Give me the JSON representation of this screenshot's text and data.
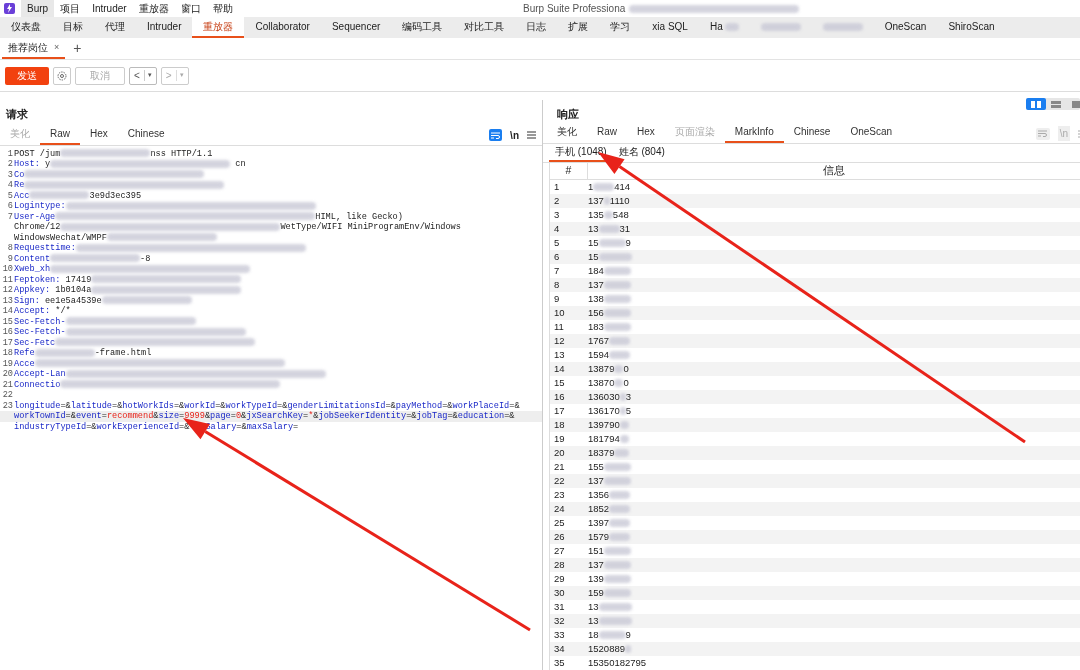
{
  "menu_bar": {
    "items": [
      {
        "label": "Burp",
        "selected": true
      },
      {
        "label": "项目",
        "selected": false
      },
      {
        "label": "Intruder",
        "selected": false
      },
      {
        "label": "重放器",
        "selected": false
      },
      {
        "label": "窗口",
        "selected": false
      },
      {
        "label": "帮助",
        "selected": false
      }
    ],
    "title": "Burp Suite Professiona"
  },
  "main_tabs": [
    {
      "label": "仪表盘",
      "selected": false
    },
    {
      "label": "目标",
      "selected": false
    },
    {
      "label": "代理",
      "selected": false
    },
    {
      "label": "Intruder",
      "selected": false
    },
    {
      "label": "重放器",
      "selected": true
    },
    {
      "label": "Collaborator",
      "selected": false
    },
    {
      "label": "Sequencer",
      "selected": false
    },
    {
      "label": "编码工具",
      "selected": false
    },
    {
      "label": "对比工具",
      "selected": false
    },
    {
      "label": "日志",
      "selected": false
    },
    {
      "label": "扩展",
      "selected": false
    },
    {
      "label": "学习",
      "selected": false
    },
    {
      "label": "xia SQL",
      "selected": false
    },
    {
      "label": "Ha",
      "selected": false,
      "redacted": true
    },
    {
      "selected": false,
      "redacted": true
    },
    {
      "selected": false,
      "redacted": true
    },
    {
      "label": "OneScan",
      "selected": false
    },
    {
      "label": "ShiroScan",
      "selected": false
    }
  ],
  "repeater_tabs": [
    {
      "label": "推荐岗位",
      "close": "×",
      "selected": true
    }
  ],
  "new_tab": "+",
  "toolbar": {
    "send": "发送",
    "cancel": "取消",
    "back": "<",
    "forward": ">",
    "dropdown": "▾"
  },
  "request": {
    "title": "请求",
    "tabs": [
      {
        "label": "美化",
        "selected": false,
        "disabled": true
      },
      {
        "label": "Raw",
        "selected": true,
        "disabled": false
      },
      {
        "label": "Hex",
        "selected": false,
        "disabled": false
      },
      {
        "label": "Chinese",
        "selected": false,
        "disabled": false
      }
    ],
    "newline_toggle": "\\n",
    "lines": [
      {
        "number": "1",
        "parts": [
          {
            "kind": "text",
            "text": "POST /jum"
          },
          {
            "kind": "redaction"
          },
          {
            "kind": "text",
            "text": "nss HTTP/1.1"
          }
        ]
      },
      {
        "number": "2",
        "parts": [
          {
            "kind": "name",
            "text": "Host:"
          },
          {
            "kind": "text",
            "text": " y"
          },
          {
            "kind": "redaction"
          },
          {
            "kind": "text",
            "text": " cn"
          }
        ]
      },
      {
        "number": "3",
        "parts": [
          {
            "kind": "name",
            "text": "Co"
          },
          {
            "kind": "redaction"
          }
        ]
      },
      {
        "number": "4",
        "parts": [
          {
            "kind": "name",
            "text": "Re"
          },
          {
            "kind": "redaction"
          }
        ]
      },
      {
        "number": "5",
        "parts": [
          {
            "kind": "name",
            "text": "Acc"
          },
          {
            "kind": "redaction"
          },
          {
            "kind": "text",
            "text": "3e9d3ec395"
          }
        ]
      },
      {
        "number": "6",
        "parts": [
          {
            "kind": "name",
            "text": "Logintype:"
          },
          {
            "kind": "redaction"
          }
        ]
      },
      {
        "number": "7",
        "parts": [
          {
            "kind": "name",
            "text": "User-Age"
          },
          {
            "kind": "redaction"
          },
          {
            "kind": "text",
            "text": "HIML, like Gecko)"
          }
        ]
      },
      {
        "parts": [
          {
            "kind": "text",
            "text": "Chrome/12"
          },
          {
            "kind": "redaction"
          },
          {
            "kind": "text",
            "text": "WetType/WIFI MiniProgramEnv/Windows"
          }
        ]
      },
      {
        "parts": [
          {
            "kind": "text",
            "text": "WindowsWechat/WMPF"
          },
          {
            "kind": "redaction"
          }
        ]
      },
      {
        "number": "8",
        "parts": [
          {
            "kind": "name",
            "text": "Requesttime:"
          },
          {
            "kind": "redaction"
          }
        ]
      },
      {
        "number": "9",
        "parts": [
          {
            "kind": "name",
            "text": "Content"
          },
          {
            "kind": "redaction"
          },
          {
            "kind": "text",
            "text": "-8"
          }
        ]
      },
      {
        "number": "10",
        "parts": [
          {
            "kind": "name",
            "text": "Xweb_xh"
          },
          {
            "kind": "redaction"
          }
        ]
      },
      {
        "number": "11",
        "parts": [
          {
            "kind": "name",
            "text": "Feptoken:"
          },
          {
            "kind": "text",
            "text": " 17419"
          },
          {
            "kind": "redaction"
          }
        ]
      },
      {
        "number": "12",
        "parts": [
          {
            "kind": "name",
            "text": "Appkey:"
          },
          {
            "kind": "text",
            "text": " 1b0104a"
          },
          {
            "kind": "redaction"
          }
        ]
      },
      {
        "number": "13",
        "parts": [
          {
            "kind": "name",
            "text": "Sign:"
          },
          {
            "kind": "text",
            "text": " ee1e5a4539e"
          },
          {
            "kind": "redaction"
          }
        ]
      },
      {
        "number": "14",
        "parts": [
          {
            "kind": "name",
            "text": "Accept:"
          },
          {
            "kind": "text",
            "text": " */*"
          }
        ]
      },
      {
        "number": "15",
        "parts": [
          {
            "kind": "name",
            "text": "Sec-Fetch-"
          },
          {
            "kind": "redaction"
          }
        ]
      },
      {
        "number": "16",
        "parts": [
          {
            "kind": "name",
            "text": "Sec-Fetch-"
          },
          {
            "kind": "redaction"
          }
        ]
      },
      {
        "number": "17",
        "parts": [
          {
            "kind": "name",
            "text": "Sec-Fetc"
          },
          {
            "kind": "redaction"
          }
        ]
      },
      {
        "number": "18",
        "parts": [
          {
            "kind": "name",
            "text": "Refe"
          },
          {
            "kind": "redaction"
          },
          {
            "kind": "text",
            "text": "-frame.html"
          }
        ]
      },
      {
        "number": "19",
        "parts": [
          {
            "kind": "name",
            "text": "Acce"
          },
          {
            "kind": "redaction"
          }
        ]
      },
      {
        "number": "20",
        "parts": [
          {
            "kind": "name",
            "text": "Accept-Lan"
          },
          {
            "kind": "redaction"
          }
        ]
      },
      {
        "number": "21",
        "parts": [
          {
            "kind": "name",
            "text": "Connectio"
          },
          {
            "kind": "redaction"
          }
        ]
      },
      {
        "number": "22"
      },
      {
        "number": "23",
        "parts": [
          {
            "kind": "name",
            "text": "longitude"
          },
          {
            "kind": "text",
            "text": "=&"
          },
          {
            "kind": "name",
            "text": "latitude"
          },
          {
            "kind": "text",
            "text": "=&"
          },
          {
            "kind": "name",
            "text": "hotWorkIds"
          },
          {
            "kind": "text",
            "text": "=&"
          },
          {
            "kind": "name",
            "text": "workId"
          },
          {
            "kind": "text",
            "text": "=&"
          },
          {
            "kind": "name",
            "text": "workTypeId"
          },
          {
            "kind": "text",
            "text": "=&"
          },
          {
            "kind": "name",
            "text": "genderLimitationsId"
          },
          {
            "kind": "text",
            "text": "=&"
          },
          {
            "kind": "name",
            "text": "payMethod"
          },
          {
            "kind": "text",
            "text": "=&"
          },
          {
            "kind": "name",
            "text": "workPlaceId"
          },
          {
            "kind": "text",
            "text": "=&"
          }
        ]
      },
      {
        "highlighted": true,
        "parts": [
          {
            "kind": "name",
            "text": "workTownId"
          },
          {
            "kind": "text",
            "text": "=&"
          },
          {
            "kind": "name",
            "text": "event"
          },
          {
            "kind": "text",
            "text": "="
          },
          {
            "kind": "value",
            "text": "recommend"
          },
          {
            "kind": "text",
            "text": "&"
          },
          {
            "kind": "name",
            "text": "size"
          },
          {
            "kind": "text",
            "text": "="
          },
          {
            "kind": "value",
            "text": "9999"
          },
          {
            "kind": "text",
            "text": "&"
          },
          {
            "kind": "name",
            "text": "page"
          },
          {
            "kind": "text",
            "text": "="
          },
          {
            "kind": "value",
            "text": "0"
          },
          {
            "kind": "text",
            "text": "&"
          },
          {
            "kind": "name",
            "text": "jxSearchKey"
          },
          {
            "kind": "text",
            "text": "="
          },
          {
            "kind": "value",
            "text": "*"
          },
          {
            "kind": "text",
            "text": "&"
          },
          {
            "kind": "name",
            "text": "jobSeekerIdentity"
          },
          {
            "kind": "text",
            "text": "=&"
          },
          {
            "kind": "name",
            "text": "jobTag"
          },
          {
            "kind": "text",
            "text": "=&"
          },
          {
            "kind": "name",
            "text": "education"
          },
          {
            "kind": "text",
            "text": "=&"
          }
        ]
      },
      {
        "parts": [
          {
            "kind": "name",
            "text": "industryTypeId"
          },
          {
            "kind": "text",
            "text": "=&"
          },
          {
            "kind": "name",
            "text": "workExperienceId"
          },
          {
            "kind": "text",
            "text": "=&"
          },
          {
            "kind": "gap"
          },
          {
            "kind": "name",
            "text": "Salary"
          },
          {
            "kind": "text",
            "text": "=&"
          },
          {
            "kind": "name",
            "text": "maxSalary"
          },
          {
            "kind": "text",
            "text": "="
          }
        ]
      }
    ]
  },
  "response": {
    "title": "响应",
    "tabs": [
      {
        "label": "美化",
        "selected": false,
        "disabled": false
      },
      {
        "label": "Raw",
        "selected": false,
        "disabled": false
      },
      {
        "label": "Hex",
        "selected": false,
        "disabled": false
      },
      {
        "label": "页面渲染",
        "selected": false,
        "disabled": true
      },
      {
        "label": "MarkInfo",
        "selected": true,
        "disabled": false
      },
      {
        "label": "Chinese",
        "selected": false,
        "disabled": false
      },
      {
        "label": "OneScan",
        "selected": false,
        "disabled": false
      }
    ],
    "newline_toggle": "\\n",
    "sub_tabs": [
      {
        "label": "手机 (1048)",
        "selected": true
      },
      {
        "label": "姓名 (804)",
        "selected": false
      }
    ],
    "table": {
      "columns": [
        "#",
        "信息"
      ],
      "rows": [
        {
          "number": "1",
          "start": "1",
          "end": "414"
        },
        {
          "number": "2",
          "start": "137",
          "end": "1110"
        },
        {
          "number": "3",
          "start": "135",
          "end": "548"
        },
        {
          "number": "4",
          "start": "13",
          "end": "31"
        },
        {
          "number": "5",
          "start": "15",
          "end": "9"
        },
        {
          "number": "6",
          "start": "15"
        },
        {
          "number": "7",
          "start": "184"
        },
        {
          "number": "8",
          "start": "137"
        },
        {
          "number": "9",
          "start": "138"
        },
        {
          "number": "10",
          "start": "156"
        },
        {
          "number": "11",
          "start": "183"
        },
        {
          "number": "12",
          "start": "1767"
        },
        {
          "number": "13",
          "start": "1594"
        },
        {
          "number": "14",
          "start": "13879",
          "end": "0"
        },
        {
          "number": "15",
          "start": "13870",
          "end": "0"
        },
        {
          "number": "16",
          "start": "136030",
          "end": "3"
        },
        {
          "number": "17",
          "start": "136170",
          "end": "5"
        },
        {
          "number": "18",
          "start": "139790"
        },
        {
          "number": "19",
          "start": "181794"
        },
        {
          "number": "20",
          "start": "18379"
        },
        {
          "number": "21",
          "start": "155"
        },
        {
          "number": "22",
          "start": "137"
        },
        {
          "number": "23",
          "start": "1356"
        },
        {
          "number": "24",
          "start": "1852"
        },
        {
          "number": "25",
          "start": "1397"
        },
        {
          "number": "26",
          "start": "1579"
        },
        {
          "number": "27",
          "start": "151"
        },
        {
          "number": "28",
          "start": "137"
        },
        {
          "number": "29",
          "start": "139"
        },
        {
          "number": "30",
          "start": "159"
        },
        {
          "number": "31",
          "start": "13"
        },
        {
          "number": "32",
          "start": "13"
        },
        {
          "number": "33",
          "start": "18",
          "end": "9"
        },
        {
          "number": "34",
          "start": "1520889"
        },
        {
          "number": "35",
          "start": "15350182795"
        }
      ]
    }
  }
}
